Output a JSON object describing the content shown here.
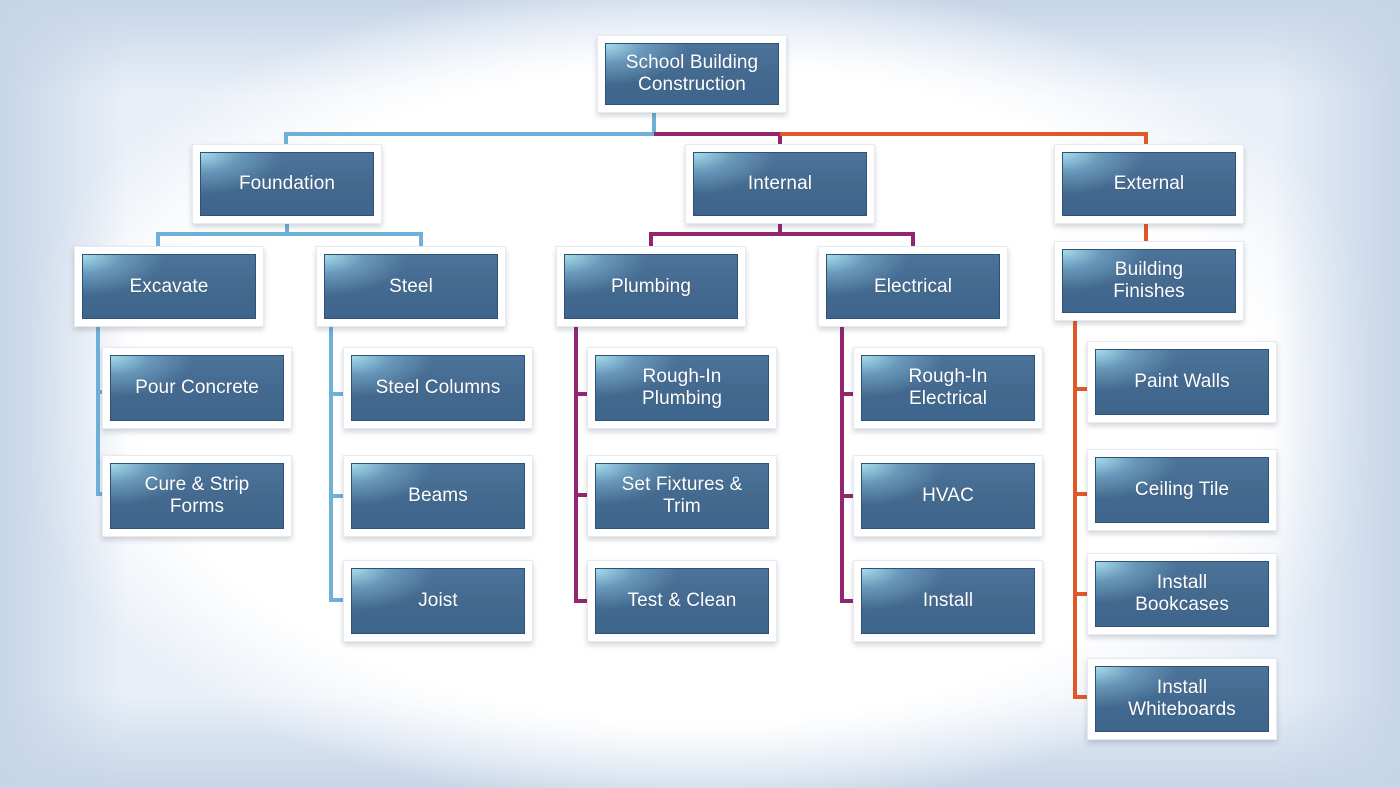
{
  "diagram": {
    "type": "work-breakdown-structure",
    "colors": {
      "foundation_branch": "#6fb0d8",
      "internal_branch": "#93266f",
      "external_branch": "#e0582a",
      "box_fill": "#43698f",
      "box_highlight": "#aae1f0",
      "box_frame": "#ffffff",
      "text": "#ffffff"
    },
    "root": {
      "label": "School Building\nConstruction"
    },
    "branches": [
      {
        "label": "Foundation",
        "color_key": "foundation_branch",
        "children": [
          {
            "label": "Excavate",
            "tasks": [
              "Pour Concrete",
              "Cure & Strip\nForms"
            ]
          },
          {
            "label": "Steel",
            "tasks": [
              "Steel Columns",
              "Beams",
              "Joist"
            ]
          }
        ]
      },
      {
        "label": "Internal",
        "color_key": "internal_branch",
        "children": [
          {
            "label": "Plumbing",
            "tasks": [
              "Rough-In\nPlumbing",
              "Set Fixtures &\nTrim",
              "Test & Clean"
            ]
          },
          {
            "label": "Electrical",
            "tasks": [
              "Rough-In\nElectrical",
              "HVAC",
              "Install"
            ]
          }
        ]
      },
      {
        "label": "External",
        "color_key": "external_branch",
        "children": [
          {
            "label": "Building\nFinishes",
            "tasks": [
              "Paint Walls",
              "Ceiling Tile",
              "Install\nBookcases",
              "Install\nWhiteboards"
            ]
          }
        ]
      }
    ]
  }
}
